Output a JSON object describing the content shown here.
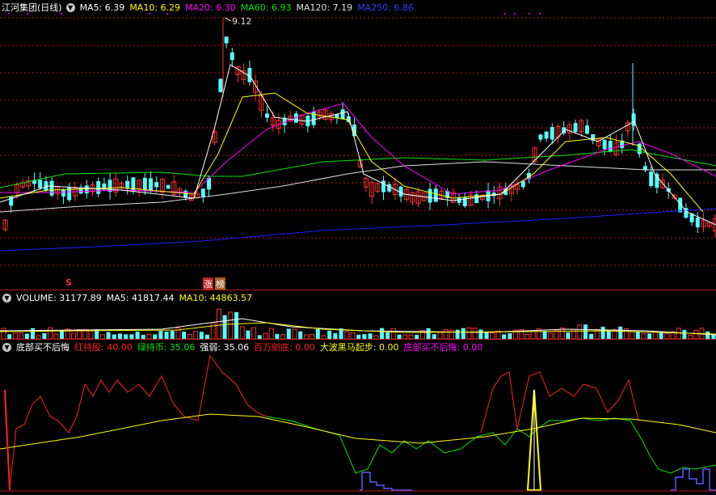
{
  "price": {
    "title": "江河集团(日线)",
    "ma": [
      {
        "label": "MA5: 6.39",
        "color": "#ffffff"
      },
      {
        "label": "MA10: 6.29",
        "color": "#ffff00"
      },
      {
        "label": "MA20: 6.30",
        "color": "#ff00ff"
      },
      {
        "label": "MA60: 6.93",
        "color": "#00e600"
      },
      {
        "label": "MA120: 7.19",
        "color": "#e0e0e0"
      },
      {
        "label": "MA250: 6.86",
        "color": "#3a3aff"
      }
    ],
    "high_label": "9.12",
    "marker_s": "S",
    "marker_zhang": "涨",
    "marker_bang": "榜"
  },
  "volume": {
    "items": [
      {
        "label": "VOLUME: 31177.89",
        "color": "#ffffff"
      },
      {
        "label": "MA5: 41817.44",
        "color": "#ffffff"
      },
      {
        "label": "MA10: 44863.57",
        "color": "#ffff00"
      }
    ]
  },
  "indicator": {
    "items": [
      {
        "label": "底部买不后悔",
        "color": "#ffffff"
      },
      {
        "label": "红持股: 40.00",
        "color": "#ff2020"
      },
      {
        "label": "绿持币: 35.06",
        "color": "#00e600"
      },
      {
        "label": "强弱: 35.06",
        "color": "#ffffff"
      },
      {
        "label": "百万剜底: 0.00",
        "color": "#ff2020"
      },
      {
        "label": "大波黑马起步: 0.00",
        "color": "#ffff00"
      },
      {
        "label": "底部买不后悔: 0.00",
        "color": "#ff00ff"
      }
    ]
  },
  "colors": {
    "up": "#ff3030",
    "down": "#54ffff",
    "grid": "#b01818",
    "ma250": "#2020ff"
  }
}
